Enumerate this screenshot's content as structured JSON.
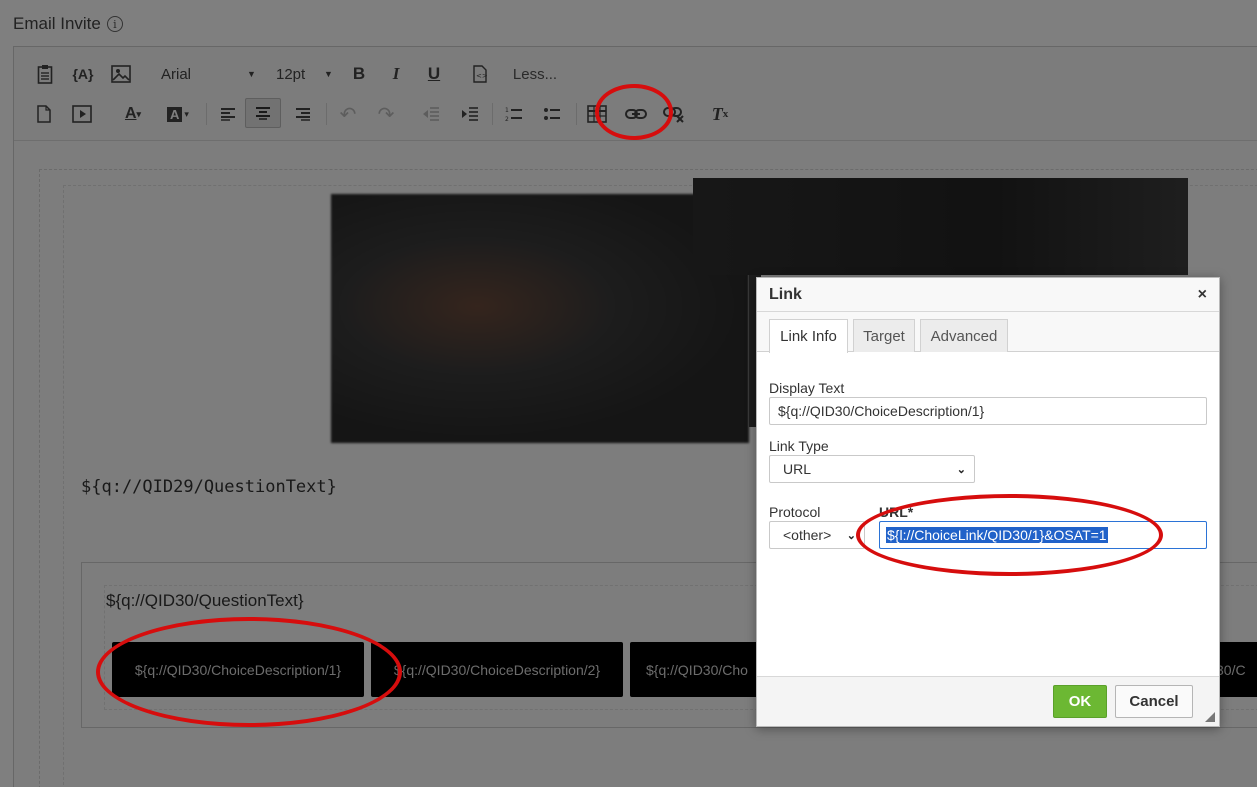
{
  "page": {
    "title": "Email Invite",
    "info_icon": "info-icon"
  },
  "toolbar": {
    "row1": {
      "paste_icon": "clipboard-icon",
      "piped_text_icon": "piped-text-icon",
      "image_icon": "image-icon",
      "font": "Arial",
      "font_size": "12pt",
      "bold": "B",
      "italic": "I",
      "underline": "U",
      "source_icon": "source-icon",
      "less": "Less..."
    },
    "row2": {
      "text_color": "A",
      "bg_color": "A",
      "remove_format": "T"
    }
  },
  "content": {
    "qid29_text": "${q://QID29/QuestionText}",
    "qid30_text": "${q://QID30/QuestionText}",
    "choices": [
      "${q://QID30/ChoiceDescription/1}",
      "${q://QID30/ChoiceDescription/2}",
      "${q://QID30/Cho",
      "30/C"
    ]
  },
  "dialog": {
    "title": "Link",
    "close": "×",
    "tabs": [
      "Link Info",
      "Target",
      "Advanced"
    ],
    "display_text_label": "Display Text",
    "display_text_value": "${q://QID30/ChoiceDescription/1}",
    "link_type_label": "Link Type",
    "link_type_value": "URL",
    "protocol_label": "Protocol",
    "protocol_value": "<other>",
    "url_label": "URL*",
    "url_value": "${l://ChoiceLink/QID30/1}&OSAT=1",
    "ok": "OK",
    "cancel": "Cancel"
  },
  "colors": {
    "annotation_red": "#d60d0d",
    "ok_green": "#6cb833",
    "selection_blue": "#2162c9"
  }
}
